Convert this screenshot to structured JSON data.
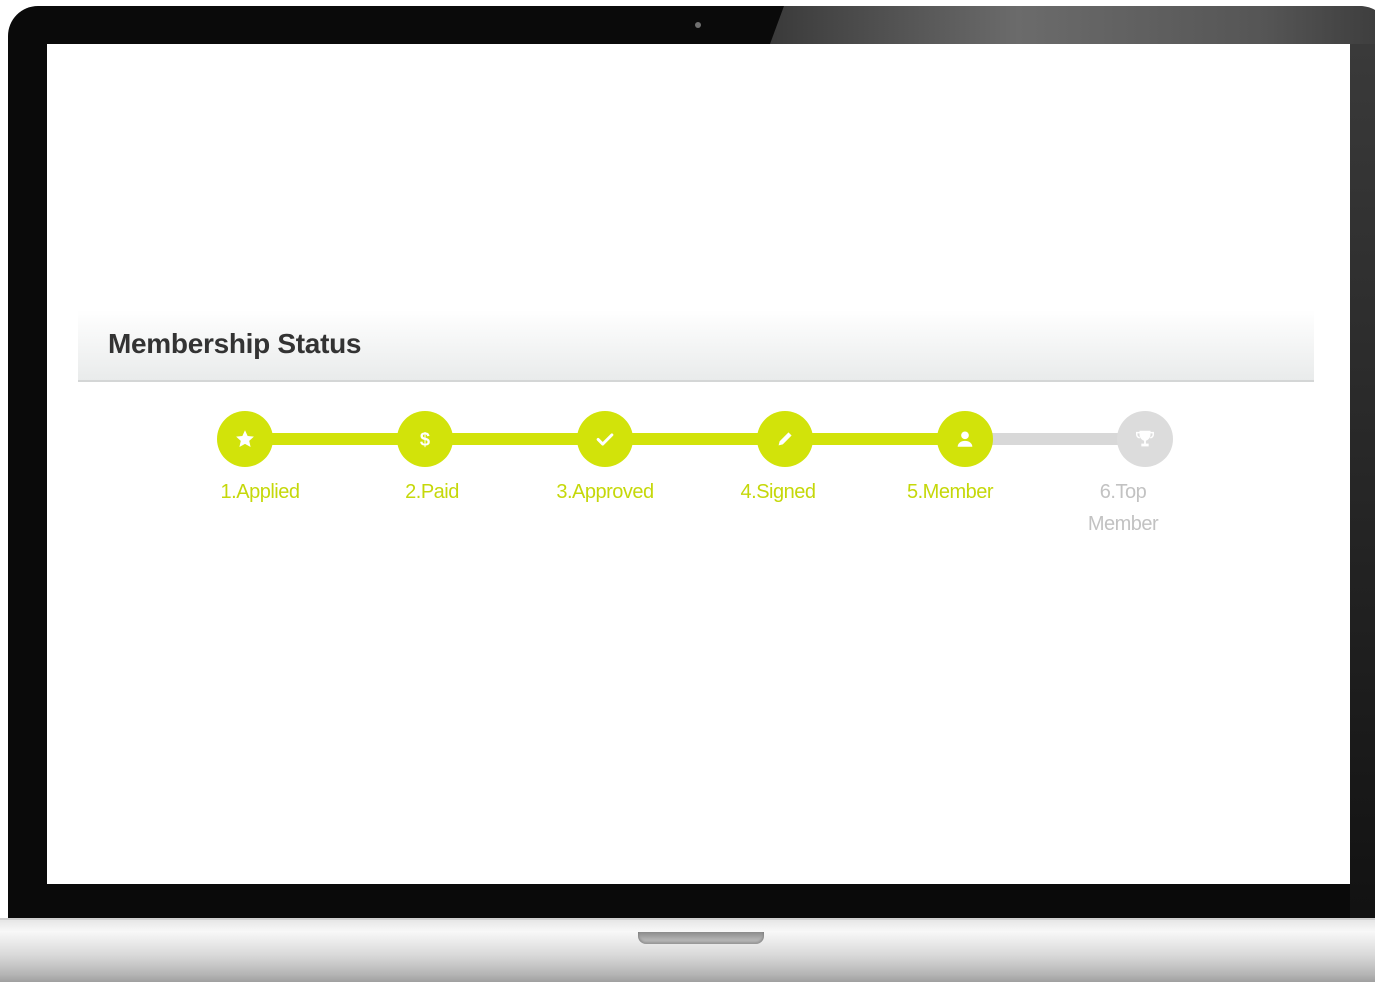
{
  "panel": {
    "title": "Membership Status"
  },
  "steps": [
    {
      "label": "1.Applied",
      "icon": "star-icon",
      "status": "done"
    },
    {
      "label": "2.Paid",
      "icon": "dollar-icon",
      "status": "done"
    },
    {
      "label": "3.Approved",
      "icon": "check-icon",
      "status": "done"
    },
    {
      "label": "4.Signed",
      "icon": "pencil-icon",
      "status": "done"
    },
    {
      "label": "5.Member",
      "icon": "user-icon",
      "status": "done"
    },
    {
      "label": "6.Top Member",
      "icon": "trophy-icon",
      "status": "todo"
    }
  ],
  "colors": {
    "active": "#d2e30a",
    "inactive": "#d8d8d8",
    "label_active": "#c5d80a",
    "label_inactive": "#c2c2c2"
  }
}
